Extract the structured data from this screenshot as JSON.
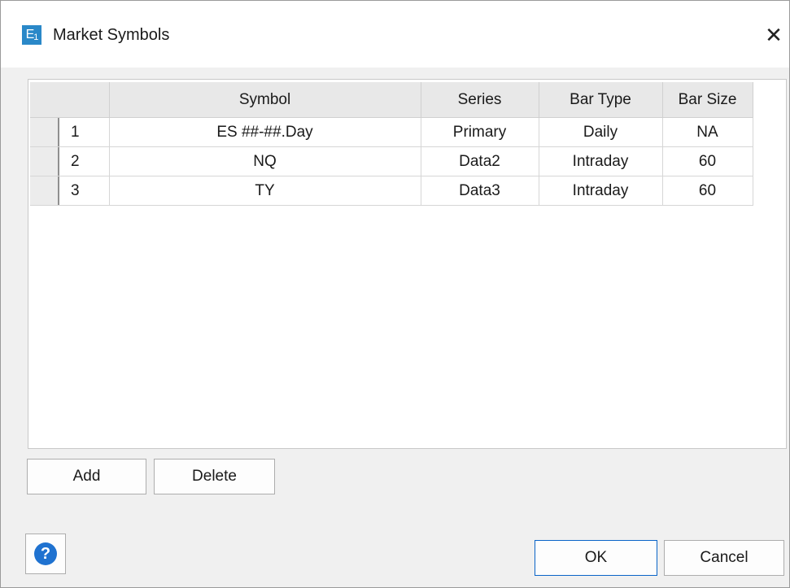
{
  "window": {
    "title": "Market Symbols",
    "icon_text": "E",
    "icon_sub": "1"
  },
  "grid": {
    "columns": [
      "",
      "Symbol",
      "Series",
      "Bar Type",
      "Bar Size"
    ],
    "rows": [
      {
        "num": "1",
        "symbol": "ES ##-##.Day",
        "series": "Primary",
        "bar_type": "Daily",
        "bar_size": "NA"
      },
      {
        "num": "2",
        "symbol": "NQ",
        "series": "Data2",
        "bar_type": "Intraday",
        "bar_size": "60"
      },
      {
        "num": "3",
        "symbol": "TY",
        "series": "Data3",
        "bar_type": "Intraday",
        "bar_size": "60"
      }
    ]
  },
  "buttons": {
    "add": "Add",
    "delete": "Delete",
    "ok": "OK",
    "cancel": "Cancel",
    "help": "?"
  },
  "colors": {
    "app_icon": "#2a88c8",
    "help_icon": "#1f72d0",
    "ok_border": "#0a64c8"
  }
}
